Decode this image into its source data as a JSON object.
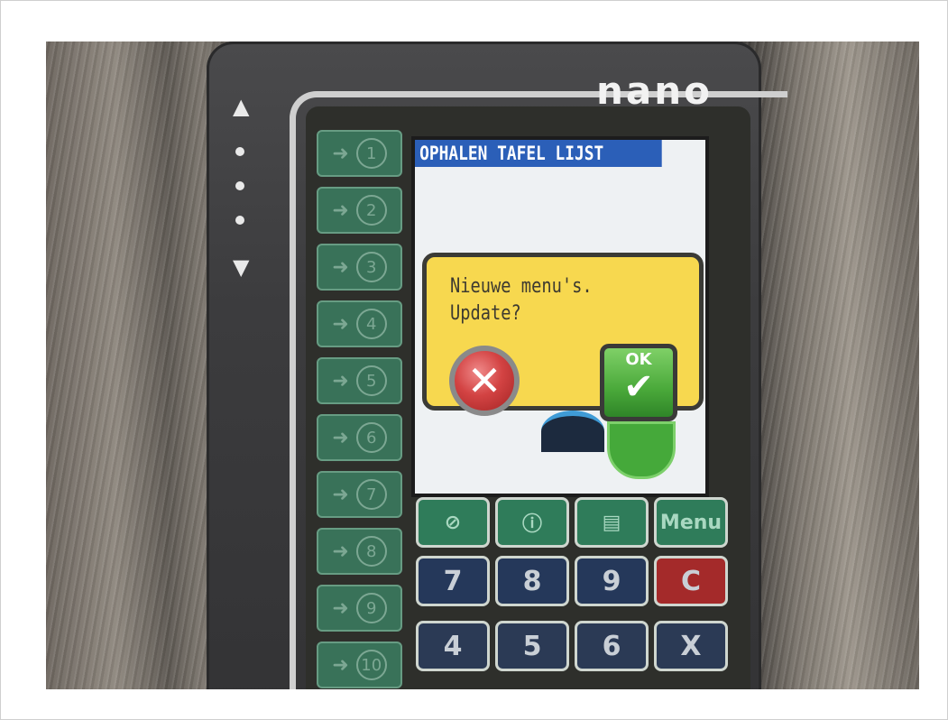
{
  "device": {
    "brand": "nano",
    "side_arrow_up": "▲",
    "side_arrow_down": "▼"
  },
  "left_keys": [
    {
      "arrow": "➜",
      "num": "1"
    },
    {
      "arrow": "➜",
      "num": "2"
    },
    {
      "arrow": "➜",
      "num": "3"
    },
    {
      "arrow": "➜",
      "num": "4"
    },
    {
      "arrow": "➜",
      "num": "5"
    },
    {
      "arrow": "➜",
      "num": "6"
    },
    {
      "arrow": "➜",
      "num": "7"
    },
    {
      "arrow": "➜",
      "num": "8"
    },
    {
      "arrow": "➜",
      "num": "9"
    },
    {
      "arrow": "➜",
      "num": "10"
    }
  ],
  "screen": {
    "title": "OPHALEN TAFEL LIJST",
    "dialog": {
      "line1": "Nieuwe menu's.",
      "line2": "Update?",
      "cancel_glyph": "✕",
      "ok_label": "OK",
      "ok_glyph": "✔"
    }
  },
  "keypad": {
    "function_row": [
      "⊘",
      "ⓘ",
      "▤",
      "Menu"
    ],
    "row1": [
      "7",
      "8",
      "9",
      "C"
    ],
    "row2": [
      "4",
      "5",
      "6",
      "X"
    ]
  },
  "colors": {
    "title_bar": "#2b5fb8",
    "dialog_bg": "#f7d84f",
    "ok_green": "#4aa93a",
    "cancel_red": "#d34343"
  }
}
